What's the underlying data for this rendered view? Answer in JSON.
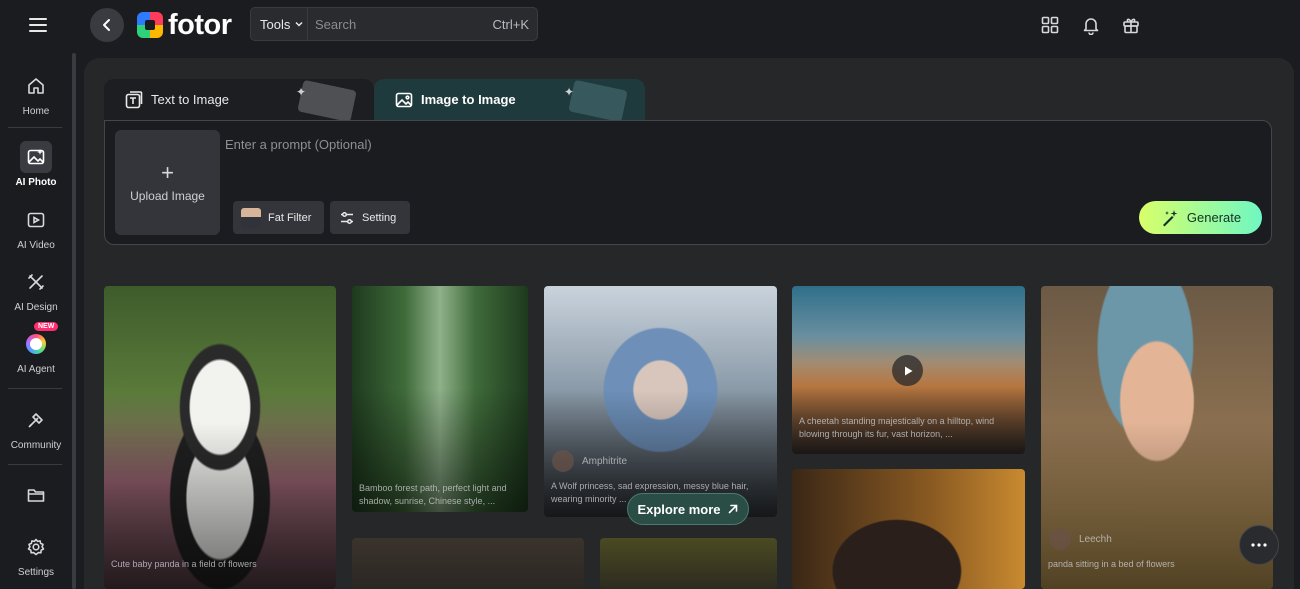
{
  "app": {
    "brand": "fotor"
  },
  "topbar": {
    "tools_label": "Tools",
    "search_placeholder": "Search",
    "shortcut": "Ctrl+K"
  },
  "sidebar": {
    "items": [
      {
        "label": "Home",
        "icon": "home-icon"
      },
      {
        "label": "AI Photo",
        "icon": "ai-photo-icon",
        "active": true
      },
      {
        "label": "AI Video",
        "icon": "ai-video-icon"
      },
      {
        "label": "AI Design",
        "icon": "ai-design-icon"
      },
      {
        "label": "AI Agent",
        "icon": "ai-agent-icon",
        "badge": "NEW"
      },
      {
        "label": "Community",
        "icon": "community-icon"
      },
      {
        "label": "",
        "icon": "folder-icon"
      },
      {
        "label": "Settings",
        "icon": "settings-icon"
      }
    ]
  },
  "tabs": [
    {
      "label": "Text to Image",
      "icon": "text-to-image-icon"
    },
    {
      "label": "Image to Image",
      "icon": "image-to-image-icon",
      "active": true
    }
  ],
  "prompt": {
    "upload_label": "Upload Image",
    "placeholder": "Enter a prompt (Optional)",
    "chips": {
      "fat_filter": "Fat Filter",
      "setting": "Setting"
    },
    "generate_label": "Generate"
  },
  "gallery": {
    "cards": [
      {
        "caption": "Cute baby panda in a field of flowers"
      },
      {
        "caption": "Bamboo forest path, perfect light and shadow, sunrise, Chinese style, ..."
      },
      {
        "author": "Amphitrite",
        "caption": "A Wolf princess, sad expression, messy blue hair, wearing minority ..."
      },
      {
        "caption": "A cheetah standing majestically on a hilltop, wind blowing through its fur, vast horizon, ..."
      },
      {
        "author": "Leechh",
        "caption": "panda sitting in a bed of flowers"
      }
    ],
    "explore_label": "Explore more"
  },
  "colors": {
    "accent_gradient_start": "#d9ff6a",
    "accent_gradient_end": "#6ff7c3",
    "active_tab": "#1f3a3c"
  }
}
